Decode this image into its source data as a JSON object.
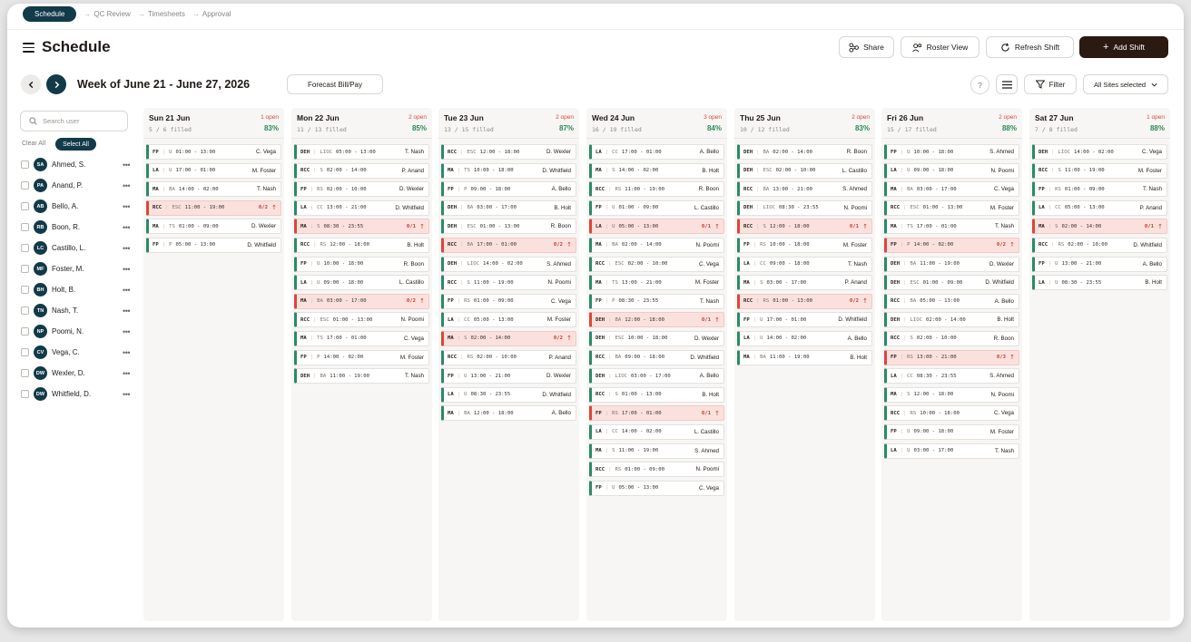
{
  "stepper": {
    "active": "Schedule",
    "steps": [
      "QC Review",
      "Timesheets",
      "Approval"
    ]
  },
  "header": {
    "title": "Schedule",
    "share": "Share",
    "roster": "Roster View",
    "refresh": "Refresh Shift",
    "add": "Add Shift"
  },
  "toolbar": {
    "week": "Week of June 21 - June 27, 2026",
    "forecast": "Forecast Bill/Pay",
    "help": "?",
    "filter": "Filter",
    "sites": "All Sites selected"
  },
  "sidebar": {
    "search_placeholder": "Search user",
    "clear_all": "Clear All",
    "select_all": "Select All",
    "users": [
      {
        "initials": "SA",
        "name": "Ahmed, S."
      },
      {
        "initials": "PA",
        "name": "Anand, P."
      },
      {
        "initials": "AB",
        "name": "Bello, A."
      },
      {
        "initials": "RB",
        "name": "Boon, R."
      },
      {
        "initials": "LC",
        "name": "Castillo, L."
      },
      {
        "initials": "MF",
        "name": "Foster, M."
      },
      {
        "initials": "BH",
        "name": "Holt, B."
      },
      {
        "initials": "TN",
        "name": "Nash, T."
      },
      {
        "initials": "NP",
        "name": "Poomi, N."
      },
      {
        "initials": "CV",
        "name": "Vega, C."
      },
      {
        "initials": "DW",
        "name": "Wexler, D."
      },
      {
        "initials": "DW",
        "name": "Whitfield, D."
      }
    ]
  },
  "colors": {
    "accent": "#123a48",
    "primary": "#2a1a12",
    "open": "#d9473a",
    "filled": "#2a8a6a",
    "pct": "#2a8a56"
  },
  "days": [
    {
      "name": "Sun 21 Jun",
      "open": "1 open",
      "filled": "5 / 6 filled",
      "pct": "83%",
      "shifts": [
        {
          "site": "FP",
          "role": "U",
          "time": "01:00 - 13:00",
          "name": "C. Vega"
        },
        {
          "site": "LA",
          "role": "U",
          "time": "17:00 - 01:00",
          "name": "M. Foster"
        },
        {
          "site": "MA",
          "role": "BA",
          "time": "14:00 - 02:00",
          "name": "T. Nash"
        },
        {
          "site": "RCC",
          "role": "ESC",
          "time": "11:00 - 19:00",
          "ratio": "0/2",
          "open": true
        },
        {
          "site": "MA",
          "role": "TS",
          "time": "01:00 - 09:00",
          "name": "D. Wexler"
        },
        {
          "site": "FP",
          "role": "P",
          "time": "05:00 - 13:00",
          "name": "D. Whitfield"
        }
      ]
    },
    {
      "name": "Mon 22 Jun",
      "open": "2 open",
      "filled": "11 / 13 filled",
      "pct": "85%",
      "shifts": [
        {
          "site": "DEH",
          "role": "LIOC",
          "time": "05:00 - 13:00",
          "name": "T. Nash"
        },
        {
          "site": "RCC",
          "role": "S",
          "time": "02:00 - 14:00",
          "name": "P. Anand"
        },
        {
          "site": "FP",
          "role": "RS",
          "time": "02:00 - 10:00",
          "name": "D. Wexler"
        },
        {
          "site": "LA",
          "role": "CC",
          "time": "13:00 - 21:00",
          "name": "D. Whitfield"
        },
        {
          "site": "MA",
          "role": "S",
          "time": "08:30 - 23:55",
          "ratio": "0/1",
          "open": true
        },
        {
          "site": "RCC",
          "role": "RS",
          "time": "12:00 - 18:00",
          "name": "B. Holt"
        },
        {
          "site": "FP",
          "role": "U",
          "time": "10:00 - 18:00",
          "name": "R. Boon"
        },
        {
          "site": "LA",
          "role": "U",
          "time": "09:00 - 18:00",
          "name": "L. Castillo"
        },
        {
          "site": "MA",
          "role": "BA",
          "time": "03:00 - 17:00",
          "ratio": "0/2",
          "open": true
        },
        {
          "site": "RCC",
          "role": "ESC",
          "time": "01:00 - 13:00",
          "name": "N. Poomi"
        },
        {
          "site": "MA",
          "role": "TS",
          "time": "17:00 - 01:00",
          "name": "C. Vega"
        },
        {
          "site": "FP",
          "role": "P",
          "time": "14:00 - 02:00",
          "name": "M. Foster"
        },
        {
          "site": "DEH",
          "role": "BA",
          "time": "11:00 - 19:00",
          "name": "T. Nash"
        }
      ]
    },
    {
      "name": "Tue 23 Jun",
      "open": "2 open",
      "filled": "13 / 15 filled",
      "pct": "87%",
      "shifts": [
        {
          "site": "RCC",
          "role": "ESC",
          "time": "12:00 - 18:00",
          "name": "D. Wexler"
        },
        {
          "site": "MA",
          "role": "TS",
          "time": "10:00 - 18:00",
          "name": "D. Whitfield"
        },
        {
          "site": "FP",
          "role": "P",
          "time": "09:00 - 18:00",
          "name": "A. Bello"
        },
        {
          "site": "DEH",
          "role": "BA",
          "time": "03:00 - 17:00",
          "name": "B. Holt"
        },
        {
          "site": "DEH",
          "role": "ESC",
          "time": "01:00 - 13:00",
          "name": "R. Boon"
        },
        {
          "site": "RCC",
          "role": "BA",
          "time": "17:00 - 01:00",
          "ratio": "0/2",
          "open": true
        },
        {
          "site": "DEH",
          "role": "LIOC",
          "time": "14:00 - 02:00",
          "name": "S. Ahmed"
        },
        {
          "site": "RCC",
          "role": "S",
          "time": "11:00 - 19:00",
          "name": "N. Poomi"
        },
        {
          "site": "FP",
          "role": "RS",
          "time": "01:00 - 09:00",
          "name": "C. Vega"
        },
        {
          "site": "LA",
          "role": "CC",
          "time": "05:00 - 13:00",
          "name": "M. Foster"
        },
        {
          "site": "MA",
          "role": "S",
          "time": "02:00 - 14:00",
          "ratio": "0/2",
          "open": true
        },
        {
          "site": "RCC",
          "role": "RS",
          "time": "02:00 - 10:00",
          "name": "P. Anand"
        },
        {
          "site": "FP",
          "role": "U",
          "time": "13:00 - 21:00",
          "name": "D. Wexler"
        },
        {
          "site": "LA",
          "role": "U",
          "time": "08:30 - 23:55",
          "name": "D. Whitfield"
        },
        {
          "site": "MA",
          "role": "BA",
          "time": "12:00 - 18:00",
          "name": "A. Bello"
        }
      ]
    },
    {
      "name": "Wed 24 Jun",
      "open": "3 open",
      "filled": "16 / 19 filled",
      "pct": "84%",
      "shifts": [
        {
          "site": "LA",
          "role": "CC",
          "time": "17:00 - 01:00",
          "name": "A. Bello"
        },
        {
          "site": "MA",
          "role": "S",
          "time": "14:00 - 02:00",
          "name": "B. Holt"
        },
        {
          "site": "RCC",
          "role": "RS",
          "time": "11:00 - 19:00",
          "name": "R. Boon"
        },
        {
          "site": "FP",
          "role": "U",
          "time": "01:00 - 09:00",
          "name": "L. Castillo"
        },
        {
          "site": "LA",
          "role": "U",
          "time": "05:00 - 13:00",
          "ratio": "0/1",
          "open": true
        },
        {
          "site": "MA",
          "role": "BA",
          "time": "02:00 - 14:00",
          "name": "N. Poomi"
        },
        {
          "site": "RCC",
          "role": "ESC",
          "time": "02:00 - 10:00",
          "name": "C. Vega"
        },
        {
          "site": "MA",
          "role": "TS",
          "time": "13:00 - 21:00",
          "name": "M. Foster"
        },
        {
          "site": "FP",
          "role": "P",
          "time": "08:30 - 23:55",
          "name": "T. Nash"
        },
        {
          "site": "DEH",
          "role": "BA",
          "time": "12:00 - 18:00",
          "ratio": "0/1",
          "open": true
        },
        {
          "site": "DEH",
          "role": "ESC",
          "time": "10:00 - 18:00",
          "name": "D. Wexler"
        },
        {
          "site": "RCC",
          "role": "BA",
          "time": "09:00 - 18:00",
          "name": "D. Whitfield"
        },
        {
          "site": "DEH",
          "role": "LIOC",
          "time": "03:00 - 17:00",
          "name": "A. Bello"
        },
        {
          "site": "RCC",
          "role": "S",
          "time": "01:00 - 13:00",
          "name": "B. Holt"
        },
        {
          "site": "FP",
          "role": "RS",
          "time": "17:00 - 01:00",
          "ratio": "0/1",
          "open": true
        },
        {
          "site": "LA",
          "role": "CC",
          "time": "14:00 - 02:00",
          "name": "L. Castillo"
        },
        {
          "site": "MA",
          "role": "S",
          "time": "11:00 - 19:00",
          "name": "S. Ahmed"
        },
        {
          "site": "RCC",
          "role": "RS",
          "time": "01:00 - 09:00",
          "name": "N. Poomi"
        },
        {
          "site": "FP",
          "role": "U",
          "time": "05:00 - 13:00",
          "name": "C. Vega"
        }
      ]
    },
    {
      "name": "Thu 25 Jun",
      "open": "2 open",
      "filled": "10 / 12 filled",
      "pct": "83%",
      "shifts": [
        {
          "site": "DEH",
          "role": "BA",
          "time": "02:00 - 14:00",
          "name": "R. Boon"
        },
        {
          "site": "DEH",
          "role": "ESC",
          "time": "02:00 - 10:00",
          "name": "L. Castillo"
        },
        {
          "site": "RCC",
          "role": "BA",
          "time": "13:00 - 21:00",
          "name": "S. Ahmed"
        },
        {
          "site": "DEH",
          "role": "LIOC",
          "time": "08:30 - 23:55",
          "name": "N. Poomi"
        },
        {
          "site": "RCC",
          "role": "S",
          "time": "12:00 - 18:00",
          "ratio": "0/1",
          "open": true
        },
        {
          "site": "FP",
          "role": "RS",
          "time": "10:00 - 18:00",
          "name": "M. Foster"
        },
        {
          "site": "LA",
          "role": "CC",
          "time": "09:00 - 18:00",
          "name": "T. Nash"
        },
        {
          "site": "MA",
          "role": "S",
          "time": "03:00 - 17:00",
          "name": "P. Anand"
        },
        {
          "site": "RCC",
          "role": "RS",
          "time": "01:00 - 13:00",
          "ratio": "0/2",
          "open": true
        },
        {
          "site": "FP",
          "role": "U",
          "time": "17:00 - 01:00",
          "name": "D. Whitfield"
        },
        {
          "site": "LA",
          "role": "U",
          "time": "14:00 - 02:00",
          "name": "A. Bello"
        },
        {
          "site": "MA",
          "role": "BA",
          "time": "11:00 - 19:00",
          "name": "B. Holt"
        }
      ]
    },
    {
      "name": "Fri 26 Jun",
      "open": "2 open",
      "filled": "15 / 17 filled",
      "pct": "88%",
      "shifts": [
        {
          "site": "FP",
          "role": "U",
          "time": "10:00 - 18:00",
          "name": "S. Ahmed"
        },
        {
          "site": "LA",
          "role": "U",
          "time": "09:00 - 18:00",
          "name": "N. Poomi"
        },
        {
          "site": "MA",
          "role": "BA",
          "time": "03:00 - 17:00",
          "name": "C. Vega"
        },
        {
          "site": "RCC",
          "role": "ESC",
          "time": "01:00 - 13:00",
          "name": "M. Foster"
        },
        {
          "site": "MA",
          "role": "TS",
          "time": "17:00 - 01:00",
          "name": "T. Nash"
        },
        {
          "site": "FP",
          "role": "P",
          "time": "14:00 - 02:00",
          "ratio": "0/2",
          "open": true
        },
        {
          "site": "DEH",
          "role": "BA",
          "time": "11:00 - 19:00",
          "name": "D. Wexler"
        },
        {
          "site": "DEH",
          "role": "ESC",
          "time": "01:00 - 09:00",
          "name": "D. Whitfield"
        },
        {
          "site": "RCC",
          "role": "BA",
          "time": "05:00 - 13:00",
          "name": "A. Bello"
        },
        {
          "site": "DEH",
          "role": "LIOC",
          "time": "02:00 - 14:00",
          "name": "B. Holt"
        },
        {
          "site": "RCC",
          "role": "S",
          "time": "02:00 - 10:00",
          "name": "R. Boon"
        },
        {
          "site": "FP",
          "role": "RS",
          "time": "13:00 - 21:00",
          "ratio": "0/3",
          "open": true
        },
        {
          "site": "LA",
          "role": "CC",
          "time": "08:30 - 23:55",
          "name": "S. Ahmed"
        },
        {
          "site": "MA",
          "role": "S",
          "time": "12:00 - 18:00",
          "name": "N. Poomi"
        },
        {
          "site": "RCC",
          "role": "RS",
          "time": "10:00 - 18:00",
          "name": "C. Vega"
        },
        {
          "site": "FP",
          "role": "U",
          "time": "09:00 - 18:00",
          "name": "M. Foster"
        },
        {
          "site": "LA",
          "role": "U",
          "time": "03:00 - 17:00",
          "name": "T. Nash"
        }
      ]
    },
    {
      "name": "Sat 27 Jun",
      "open": "1 open",
      "filled": "7 / 8 filled",
      "pct": "88%",
      "shifts": [
        {
          "site": "DEH",
          "role": "LIOC",
          "time": "14:00 - 02:00",
          "name": "C. Vega"
        },
        {
          "site": "RCC",
          "role": "S",
          "time": "11:00 - 19:00",
          "name": "M. Foster"
        },
        {
          "site": "FP",
          "role": "RS",
          "time": "01:00 - 09:00",
          "name": "T. Nash"
        },
        {
          "site": "LA",
          "role": "CC",
          "time": "05:00 - 13:00",
          "name": "P. Anand"
        },
        {
          "site": "MA",
          "role": "S",
          "time": "02:00 - 14:00",
          "ratio": "0/1",
          "open": true
        },
        {
          "site": "RCC",
          "role": "RS",
          "time": "02:00 - 10:00",
          "name": "D. Whitfield"
        },
        {
          "site": "FP",
          "role": "U",
          "time": "13:00 - 21:00",
          "name": "A. Bello"
        },
        {
          "site": "LA",
          "role": "U",
          "time": "08:30 - 23:55",
          "name": "B. Holt"
        }
      ]
    }
  ]
}
